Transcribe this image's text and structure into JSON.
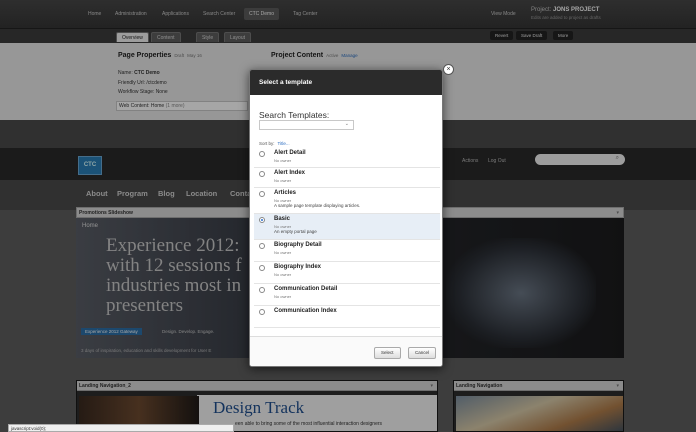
{
  "topbar": {
    "nav": [
      "Home",
      "Administration",
      "Applications",
      "Search Center",
      "CTC Demo",
      "Tag Center"
    ],
    "active_index": 4,
    "view_mode": "View Mode",
    "project_label": "Project:",
    "project_name": "JONS PROJECT",
    "project_sub": "Edits are added to project as drafts"
  },
  "subbar": {
    "tabs": [
      "Overview",
      "Content",
      "Style",
      "Layout"
    ],
    "selected_tab": 0,
    "revert": "Revert",
    "save_draft": "Save Draft",
    "more": "More"
  },
  "properties": {
    "page_title": "Page Properties",
    "page_status": "Draft",
    "page_date": "May 16",
    "name_label": "Name:",
    "name_value": "CTC Demo",
    "friendly_url": "Friendly Url: /ctcdemo",
    "workflow": "Workflow Stage: None",
    "web_content": "Web Content: Home",
    "web_content_more": "(1 more)",
    "project_title": "Project Content",
    "project_action": "Active",
    "project_manage": "Manage"
  },
  "site": {
    "logo": "CTC",
    "nav": [
      "About",
      "Program",
      "Blog",
      "Location",
      "Conta"
    ],
    "actions": "Actions",
    "logout": "Log Out"
  },
  "slideshow": {
    "header": "Promotions Slideshow",
    "label": "Home",
    "title": "Experience 2012: with 12 sessions f industries most in presenters",
    "tag": "Experience 2012 Gateway",
    "tag2": "Design. Develop. Engage.",
    "sub": "3 days of inspiration, education and skills development for User E"
  },
  "landing": {
    "header": "Landing Navigation_2",
    "title": "Design Track",
    "text": "een able to bring some of the most influential interaction designers"
  },
  "landing_right": {
    "header": "Landing Navigation"
  },
  "statusbar": "javascript:void(0);",
  "modal": {
    "title": "Select a template",
    "close": "×",
    "search_label": "Search Templates:",
    "search_value": "",
    "sort_by": "Sort by:",
    "sort_value": "Title...",
    "items": [
      {
        "name": "Alert Detail",
        "owner": "No owner",
        "desc": ""
      },
      {
        "name": "Alert Index",
        "owner": "No owner",
        "desc": ""
      },
      {
        "name": "Articles",
        "owner": "No owner",
        "desc": "A sample page template displaying articles."
      },
      {
        "name": "Basic",
        "owner": "No owner",
        "desc": "An empty portal page"
      },
      {
        "name": "Biography Detail",
        "owner": "No owner",
        "desc": ""
      },
      {
        "name": "Biography Index",
        "owner": "No owner",
        "desc": ""
      },
      {
        "name": "Communication Detail",
        "owner": "No owner",
        "desc": ""
      },
      {
        "name": "Communication Index",
        "owner": "",
        "desc": ""
      }
    ],
    "selected_index": 3,
    "select_btn": "Select",
    "cancel_btn": "Cancel"
  }
}
